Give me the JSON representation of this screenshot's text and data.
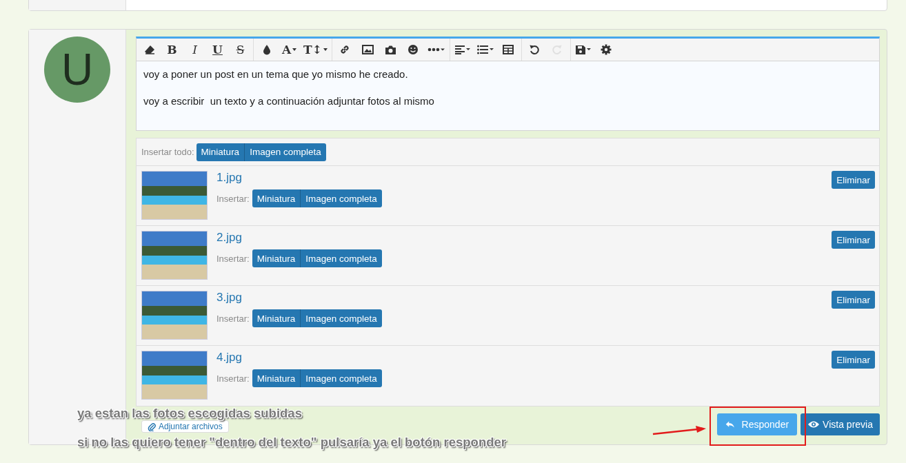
{
  "avatar": {
    "letter": "U"
  },
  "editor": {
    "toolbar": [
      [
        {
          "kind": "eraser",
          "disabled": false
        },
        {
          "kind": "bold",
          "label": "B",
          "disabled": false
        },
        {
          "kind": "italic",
          "label": "I",
          "disabled": false
        },
        {
          "kind": "underline",
          "label": "U",
          "disabled": false
        },
        {
          "kind": "strike",
          "label": "S",
          "disabled": false
        }
      ],
      [
        {
          "kind": "drop",
          "disabled": false
        },
        {
          "kind": "font",
          "label": "A",
          "disabled": false
        },
        {
          "kind": "size",
          "label": "T↕",
          "disabled": false
        }
      ],
      [
        {
          "kind": "link",
          "disabled": false
        },
        {
          "kind": "image",
          "disabled": false
        },
        {
          "kind": "camera",
          "disabled": false
        },
        {
          "kind": "smiley",
          "disabled": false
        },
        {
          "kind": "more",
          "disabled": false
        }
      ],
      [
        {
          "kind": "align",
          "disabled": false
        },
        {
          "kind": "list",
          "disabled": false
        },
        {
          "kind": "table",
          "disabled": false
        }
      ],
      [
        {
          "kind": "undo",
          "disabled": false
        },
        {
          "kind": "redo",
          "disabled": true
        }
      ],
      [
        {
          "kind": "save",
          "disabled": false
        },
        {
          "kind": "gear",
          "disabled": false
        }
      ]
    ],
    "paragraphs": [
      "voy a poner un post en un tema que yo mismo he creado.",
      "voy a escribir  un texto y a continuación adjuntar fotos al mismo"
    ]
  },
  "attachments": {
    "insert_all_label": "Insertar todo:",
    "insert_all_buttons": [
      "Miniatura",
      "Imagen completa"
    ],
    "files": [
      {
        "name": "1.jpg",
        "insert_label": "Insertar:",
        "buttons": [
          "Miniatura",
          "Imagen completa"
        ],
        "delete": "Eliminar"
      },
      {
        "name": "2.jpg",
        "insert_label": "Insertar:",
        "buttons": [
          "Miniatura",
          "Imagen completa"
        ],
        "delete": "Eliminar"
      },
      {
        "name": "3.jpg",
        "insert_label": "Insertar:",
        "buttons": [
          "Miniatura",
          "Imagen completa"
        ],
        "delete": "Eliminar"
      },
      {
        "name": "4.jpg",
        "insert_label": "Insertar:",
        "buttons": [
          "Miniatura",
          "Imagen completa"
        ],
        "delete": "Eliminar"
      }
    ]
  },
  "actions": {
    "attach": "Adjuntar archivos",
    "reply": "Responder",
    "preview": "Vista previa"
  },
  "annotation": {
    "lines": [
      "ya estan las fotos escogidas subidas",
      "si no las quiero tener \"dentro del texto\" pulsaría ya el botón responder"
    ]
  }
}
